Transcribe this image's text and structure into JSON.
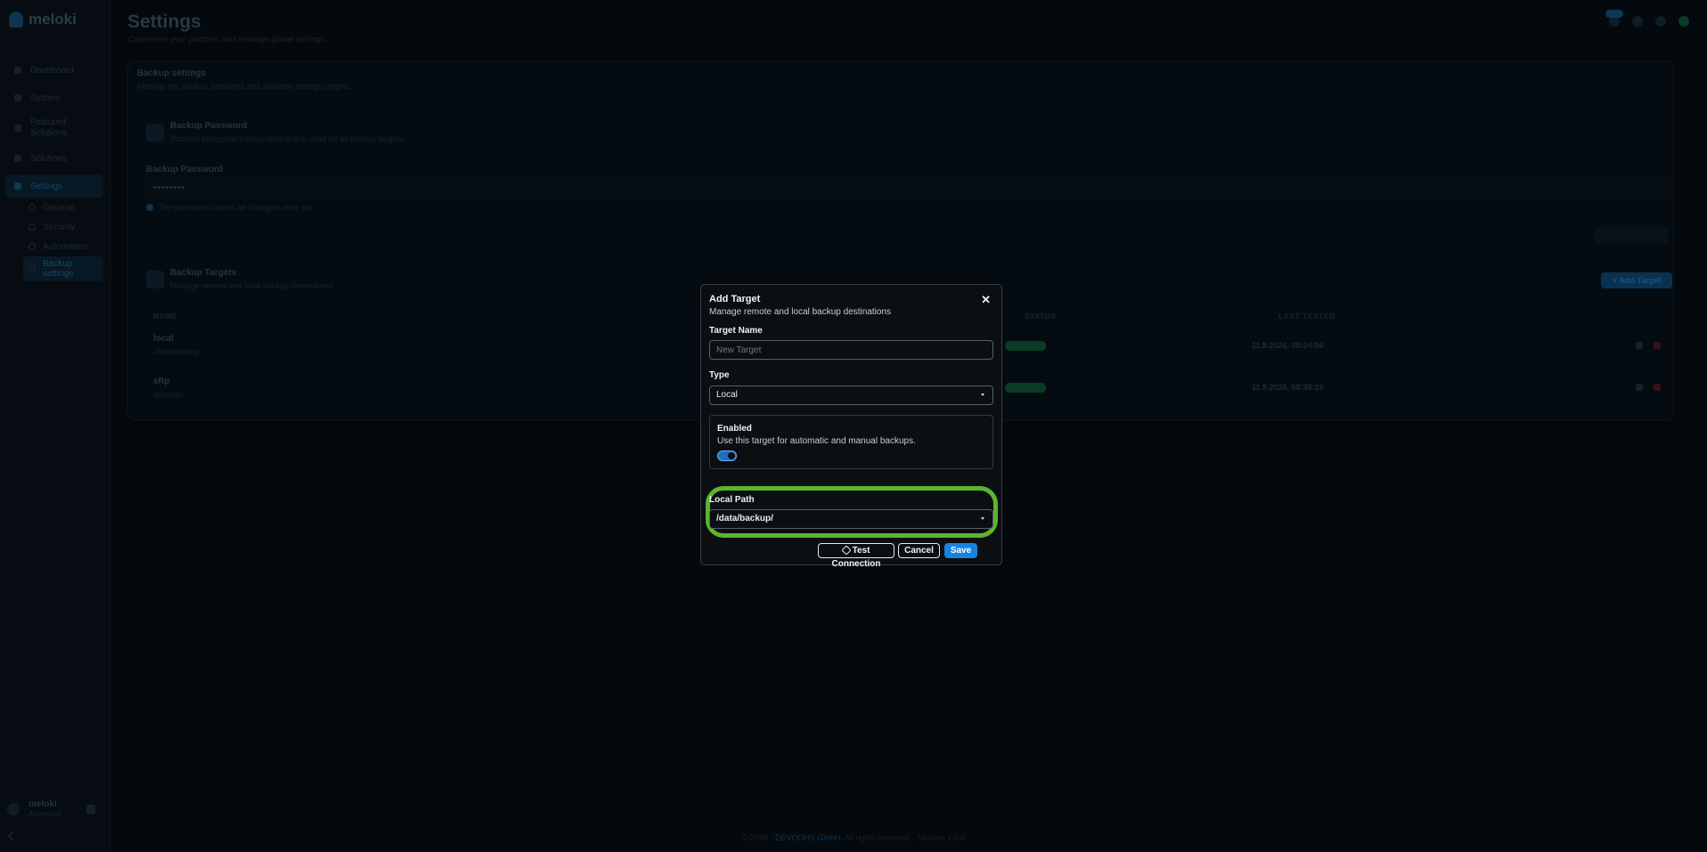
{
  "app": {
    "brand": "meloki"
  },
  "sidebar": {
    "items": [
      {
        "label": "Dashboard"
      },
      {
        "label": "System"
      },
      {
        "label": "Featured Solutions"
      },
      {
        "label": "Solutions"
      },
      {
        "label": "Settings"
      }
    ],
    "subitems": [
      {
        "label": "General"
      },
      {
        "label": "Security"
      },
      {
        "label": "Automation"
      },
      {
        "label": "Backup settings"
      }
    ],
    "user": {
      "name": "meloki",
      "role": "Administr..."
    }
  },
  "header": {
    "title": "Settings",
    "subtitle": "Customize your platform and manage global settings.",
    "notification_count": "3/5"
  },
  "backup": {
    "title": "Backup settings",
    "subtitle": "Manage the backup password and available storage targets.",
    "password_card": {
      "title": "Backup Password",
      "subtitle": "Protects encrypted backup data and is used for all backup targets."
    },
    "password_label": "Backup Password",
    "password_value": "••••••••",
    "password_note": "The password cannot be changed once set.",
    "targets_card": {
      "title": "Backup Targets",
      "subtitle": "Manage remote and local backup destinations"
    },
    "add_target_label": "+ Add Target",
    "columns": {
      "name": "NAME",
      "status": "STATUS",
      "last_tested": "LAST TESTED"
    },
    "rows": [
      {
        "name": "local",
        "path": "/data/backup",
        "status": "Enabled",
        "last_tested": "11.8.2026, 08:24:56"
      },
      {
        "name": "sftp",
        "path": "/backup",
        "status": "Enabled",
        "last_tested": "11.8.2026, 08:38:15"
      }
    ]
  },
  "footer": {
    "prefix": "© 2026 · ",
    "company": "DEVOOHS GmbH",
    "suffix": ". All rights reserved. · Version 1.0.0"
  },
  "modal": {
    "title": "Add Target",
    "subtitle": "Manage remote and local backup destinations",
    "name_label": "Target Name",
    "name_placeholder": "New Target",
    "type_label": "Type",
    "type_value": "Local",
    "enabled_title": "Enabled",
    "enabled_desc": "Use this target for automatic and manual backups.",
    "enabled": true,
    "path_label": "Local Path",
    "path_value": "/data/backup/",
    "test_label": "Test Connection",
    "cancel_label": "Cancel",
    "save_label": "Save"
  },
  "colors": {
    "accent": "#1882de",
    "highlight": "#5cb531",
    "background": "#04090d"
  }
}
